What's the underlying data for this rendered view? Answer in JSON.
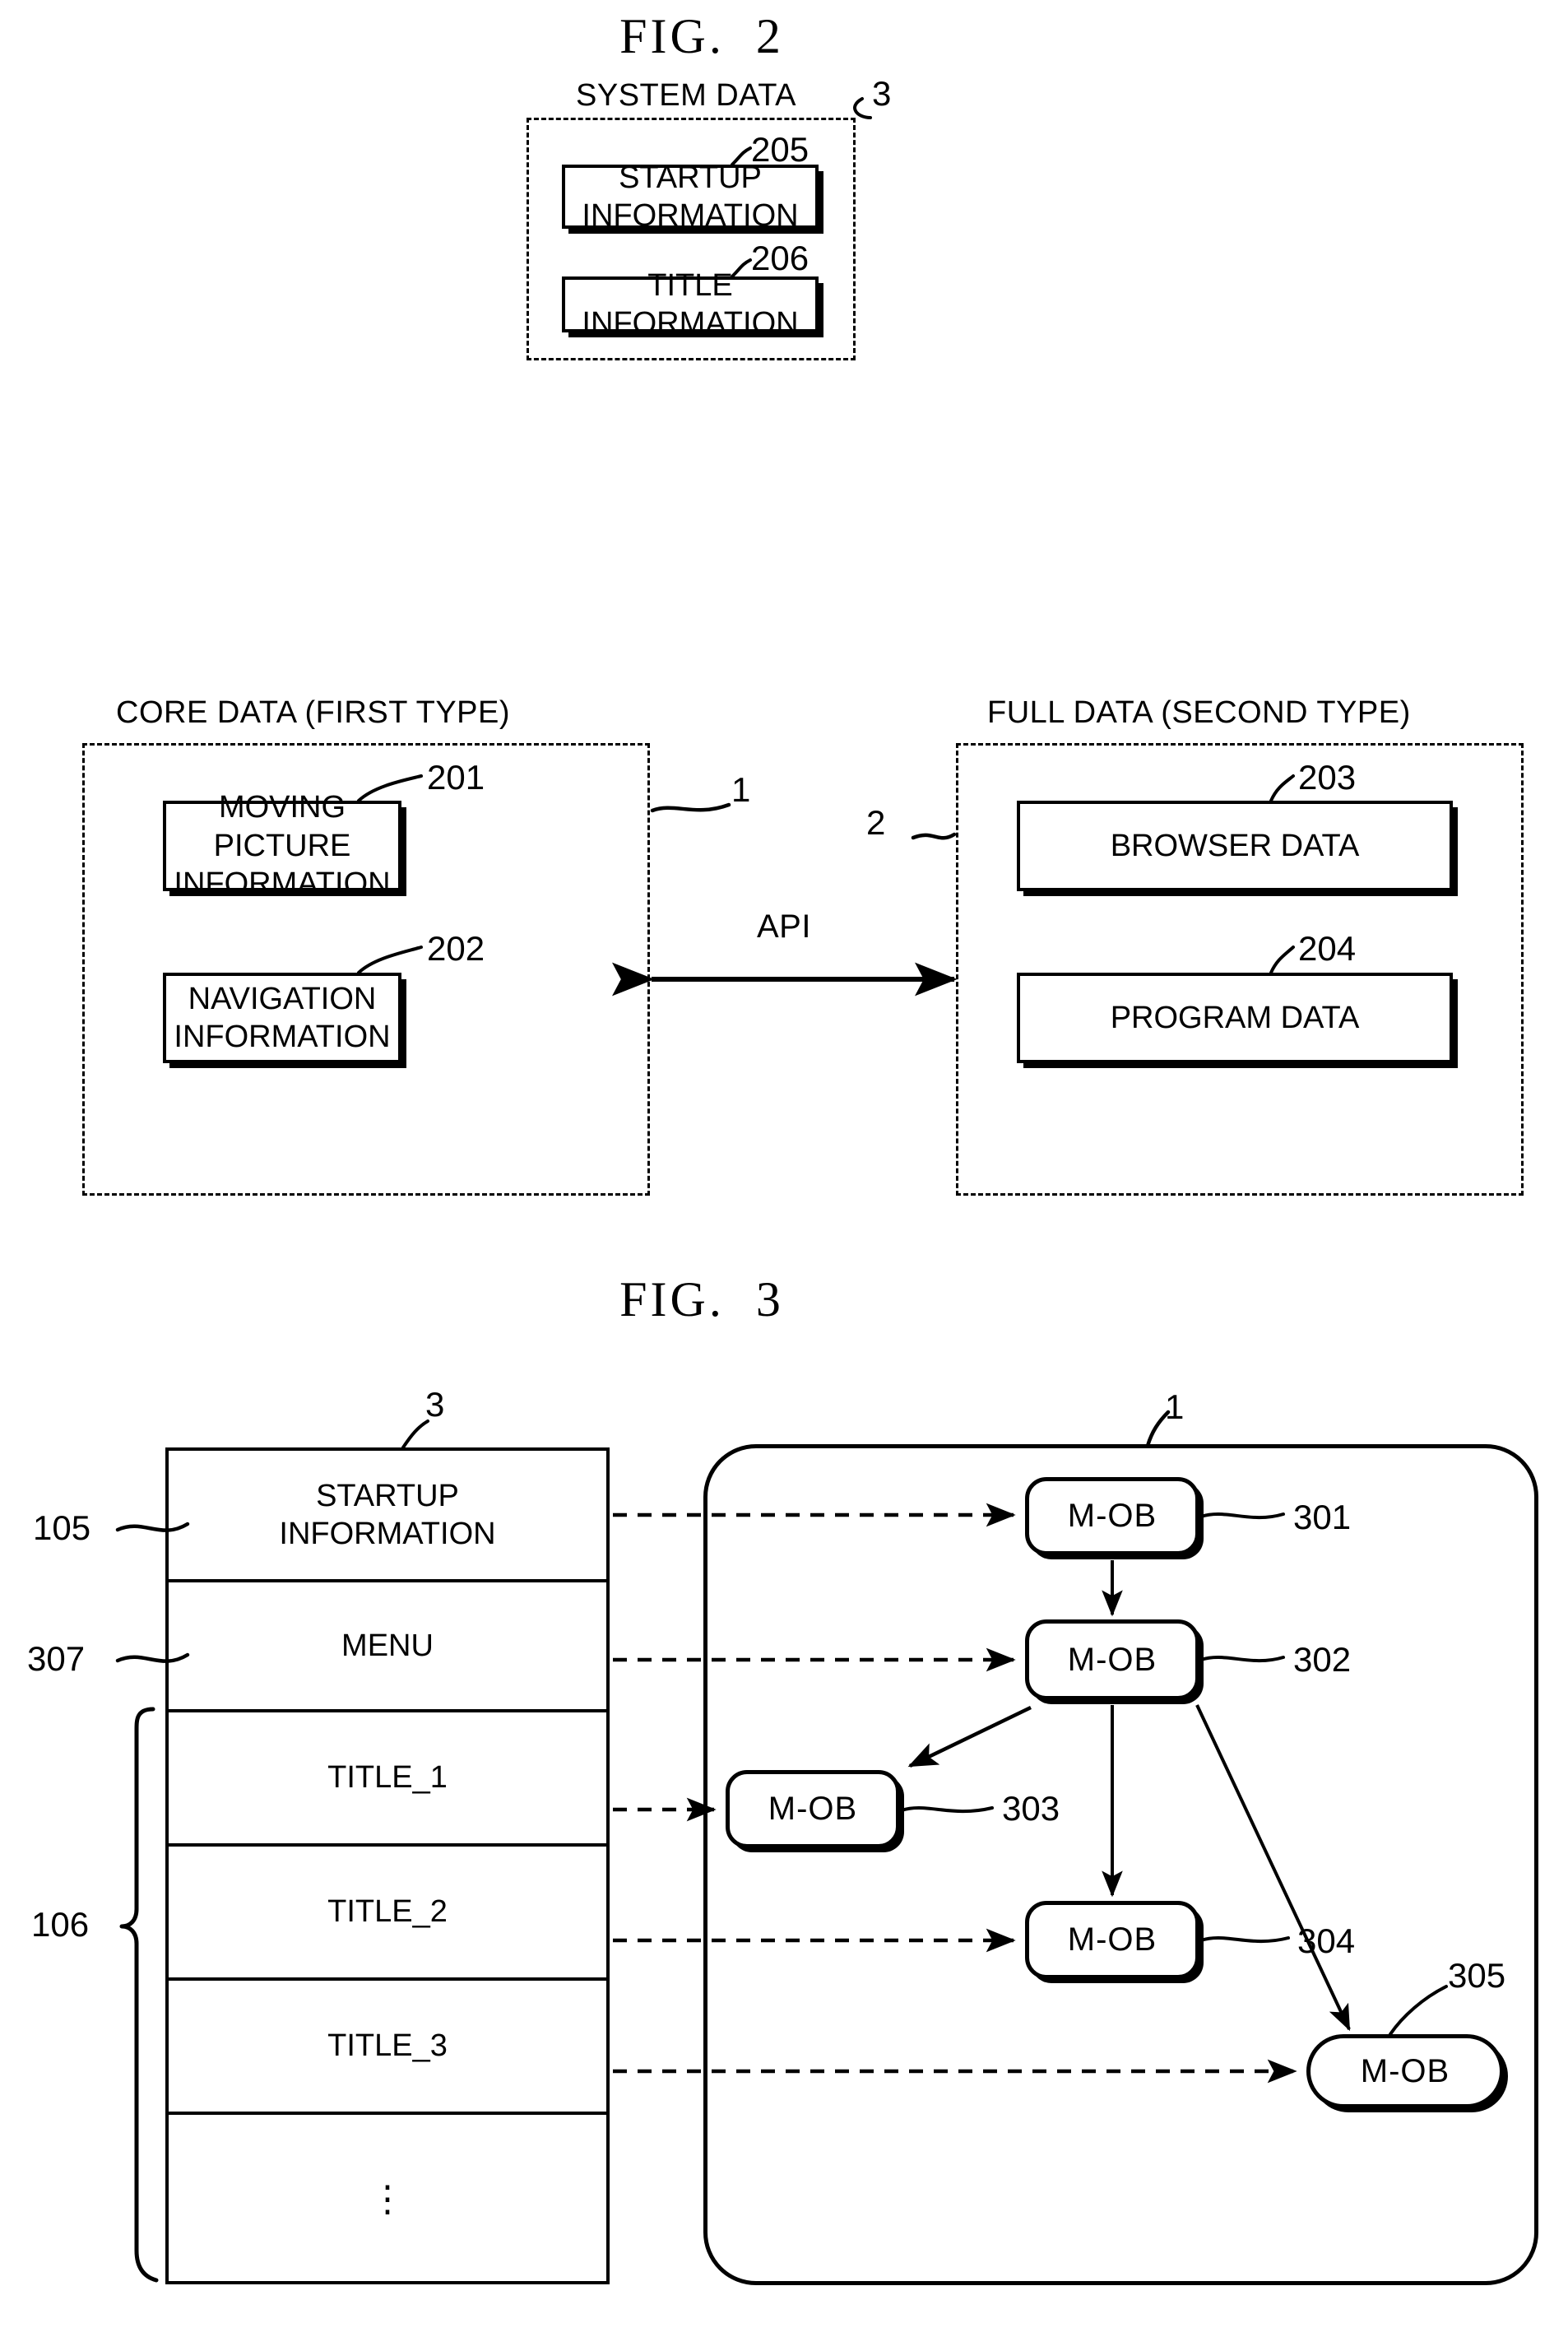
{
  "figures": [
    {
      "title": "FIG.  2",
      "caption_system": "SYSTEM DATA",
      "caption_core": "CORE DATA (FIRST TYPE)",
      "caption_full": "FULL DATA (SECOND TYPE)",
      "api_label": "API",
      "refs": {
        "system_group": "3",
        "core_group": "1",
        "full_group": "2",
        "moving_picture": "201",
        "navigation": "202",
        "browser": "203",
        "program": "204",
        "startup": "205",
        "title_info": "206"
      },
      "boxes": {
        "startup_information": "STARTUP\nINFORMATION",
        "title_information": "TITLE INFORMATION",
        "moving_picture_information": "MOVING PICTURE\nINFORMATION",
        "navigation_information": "NAVIGATION\nINFORMATION",
        "browser_data": "BROWSER DATA",
        "program_data": "PROGRAM DATA"
      }
    },
    {
      "title": "FIG.  3",
      "refs": {
        "table_group": "3",
        "startup_row": "105",
        "menu_row": "307",
        "titles_group": "106",
        "container_group": "1",
        "node1": "301",
        "node2": "302",
        "node3": "303",
        "node4": "304",
        "node5": "305"
      },
      "table_rows": [
        {
          "label": "STARTUP\nINFORMATION"
        },
        {
          "label": "MENU"
        },
        {
          "label": "TITLE_1"
        },
        {
          "label": "TITLE_2"
        },
        {
          "label": "TITLE_3"
        },
        {
          "label": "⋮"
        }
      ],
      "nodes": [
        {
          "label": "M-OB",
          "ref": "301"
        },
        {
          "label": "M-OB",
          "ref": "302"
        },
        {
          "label": "M-OB",
          "ref": "303"
        },
        {
          "label": "M-OB",
          "ref": "304"
        },
        {
          "label": "M-OB",
          "ref": "305"
        }
      ]
    }
  ],
  "colors": {
    "ink": "#000000",
    "paper": "#ffffff"
  }
}
